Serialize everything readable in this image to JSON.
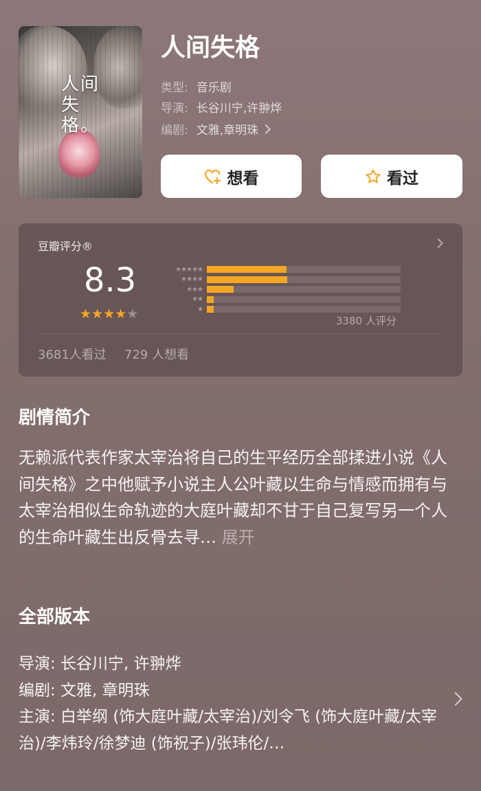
{
  "work": {
    "title": "人间失格",
    "poster_title": "人间失格。",
    "type_label": "类型:",
    "type_value": "音乐剧",
    "director_label": "导演:",
    "director_value": "长谷川宁,许翀烨",
    "writer_label": "编剧:",
    "writer_value": "文雅,章明珠"
  },
  "actions": {
    "want_label": "想看",
    "seen_label": "看过"
  },
  "rating": {
    "label": "豆瓣评分®",
    "score": "8.3",
    "stars_filled": 4,
    "stars_total": 5,
    "distribution": [
      {
        "stars": "★★★★★",
        "fraction": 0.41
      },
      {
        "stars": "★★★★",
        "fraction": 0.415
      },
      {
        "stars": "★★★",
        "fraction": 0.14
      },
      {
        "stars": "★★",
        "fraction": 0.035
      },
      {
        "stars": "★",
        "fraction": 0.035
      }
    ],
    "count_text": "3380 人评分",
    "seen_text": "3681人看过",
    "want_text": "729 人想看"
  },
  "synopsis": {
    "heading": "剧情简介",
    "text": "无赖派代表作家太宰治将自己的生平经历全部揉进小说《人间失格》之中他赋予小说主人公叶藏以生命与情感而拥有与太宰治相似生命轨迹的大庭叶藏却不甘于自己复写另一个人的生命叶藏生出反骨去寻…",
    "more_label": "展开"
  },
  "versions": {
    "heading": "全部版本",
    "director_line": "导演: 长谷川宁, 许翀烨",
    "writer_line": "编剧: 文雅, 章明珠",
    "cast_line": "主演: 白举纲 (饰大庭叶藏/太宰治)/刘令飞 (饰大庭叶藏/太宰治)/李炜玲/徐梦迪 (饰祝子)/张玮伦/…"
  },
  "colors": {
    "accent": "#f5a623",
    "background": "#85706f"
  }
}
